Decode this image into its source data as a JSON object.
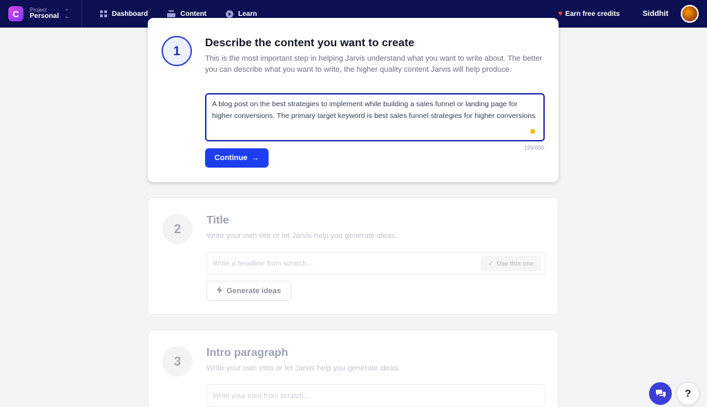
{
  "nav": {
    "project_label": "Project",
    "project_name": "Personal",
    "links": [
      {
        "label": "Dashboard",
        "icon": "grid-icon"
      },
      {
        "label": "Content",
        "icon": "stack-icon"
      },
      {
        "label": "Learn",
        "icon": "play-circle-icon"
      }
    ],
    "credits_label": "Earn free credits",
    "user_name": "Siddhit"
  },
  "step1": {
    "number": "1",
    "title": "Describe the content you want to create",
    "description": "This is the most important step in helping Jarvis understand what you want to write about. The better you can describe what you want to write, the higher quality content Jarvis will help produce.",
    "input_value": "A blog post on the best strategies to implement while building a sales funnel or landing page for higher conversions. The primary target keyword is best sales funnel strategies for higher conversions",
    "char_count": "199/600",
    "continue_label": "Continue",
    "continue_arrow": "→"
  },
  "step2": {
    "number": "2",
    "title": "Title",
    "description": "Write your own title or let Jarvis help you generate ideas.",
    "input_placeholder": "Write a headline from scratch...",
    "use_label": "Use this one",
    "generate_label": "Generate ideas"
  },
  "step3": {
    "number": "3",
    "title": "Intro paragraph",
    "description": "Write your own intro or let Jarvis help you generate ideas.",
    "input_placeholder": "Write your intro from scratch..."
  },
  "floating": {
    "help_label": "?"
  },
  "colors": {
    "nav_bg": "#0c0f52",
    "primary": "#1d3ef0",
    "accent_dot": "#f5b90b",
    "heart": "#ef4444"
  }
}
